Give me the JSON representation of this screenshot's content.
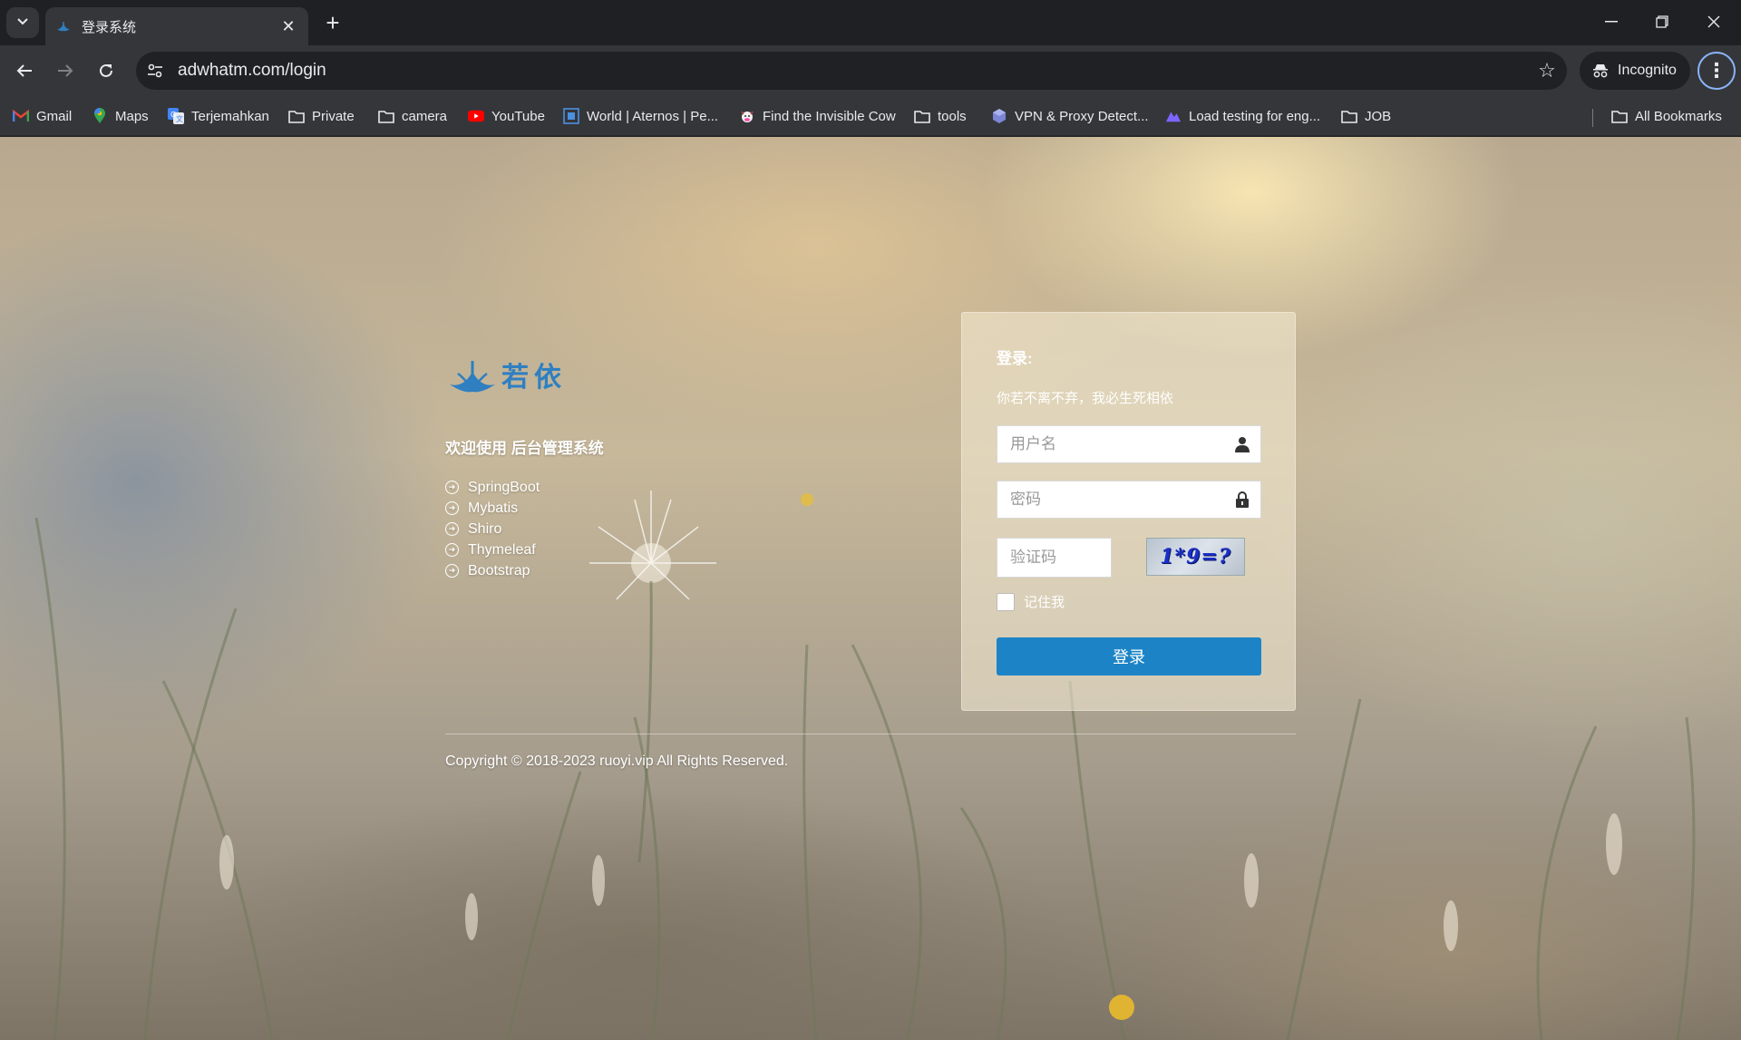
{
  "browser": {
    "tab_title": "登录系统",
    "url": "adwhatm.com/login",
    "incognito_label": "Incognito"
  },
  "bookmarks": [
    {
      "label": "Gmail",
      "icon": "gmail-icon"
    },
    {
      "label": "Maps",
      "icon": "maps-icon"
    },
    {
      "label": "Terjemahkan",
      "icon": "translate-icon"
    },
    {
      "label": "Private",
      "icon": "folder-icon"
    },
    {
      "label": "camera",
      "icon": "folder-icon"
    },
    {
      "label": "YouTube",
      "icon": "youtube-icon"
    },
    {
      "label": "World | Aternos | Pe...",
      "icon": "aternos-icon"
    },
    {
      "label": "Find the Invisible Cow",
      "icon": "cow-icon"
    },
    {
      "label": "tools",
      "icon": "folder-icon"
    },
    {
      "label": "VPN & Proxy Detect...",
      "icon": "cube-icon"
    },
    {
      "label": "Load testing for eng...",
      "icon": "k6-icon"
    },
    {
      "label": "JOB",
      "icon": "folder-icon"
    }
  ],
  "all_bookmarks_label": "All Bookmarks",
  "intro": {
    "logo_text": "若依",
    "welcome": "欢迎使用 后台管理系统",
    "features": [
      "SpringBoot",
      "Mybatis",
      "Shiro",
      "Thymeleaf",
      "Bootstrap"
    ]
  },
  "login": {
    "title": "登录:",
    "subtitle": "你若不离不弃，我必生死相依",
    "username_placeholder": "用户名",
    "password_placeholder": "密码",
    "captcha_placeholder": "验证码",
    "captcha_text": "1*9=?",
    "remember_label": "记住我",
    "submit_label": "登录"
  },
  "footer": {
    "copyright": "Copyright © 2018-2023 ruoyi.vip All Rights Reserved."
  },
  "colors": {
    "primary_button": "#1c84c6",
    "chrome_dark": "#35363a"
  }
}
